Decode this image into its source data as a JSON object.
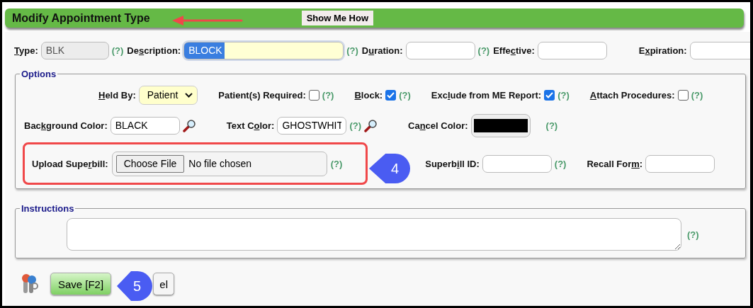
{
  "header": {
    "title": "Modify Appointment Type",
    "button": "Show Me How"
  },
  "top_fields": [
    {
      "kind": "readonly",
      "label": {
        "key": "T",
        "post": "ype:"
      },
      "value": "BLK",
      "help": "(?)"
    },
    {
      "kind": "text",
      "label": {
        "pre": "De",
        "key": "s",
        "post": "cription:"
      },
      "value": "BLOCK",
      "focused": true,
      "help": "(?)"
    },
    {
      "kind": "text",
      "label": {
        "pre": "D",
        "key": "u",
        "post": "ration:"
      },
      "help": "(?)"
    },
    {
      "kind": "text",
      "label": {
        "pre": "Effe",
        "key": "c",
        "post": "tive:"
      }
    },
    {
      "kind": "text",
      "label": {
        "pre": "E",
        "key": "x",
        "post": "piration:"
      }
    }
  ],
  "options": {
    "legend": "Options",
    "held_row": [
      {
        "kind": "select",
        "label": {
          "key": "H",
          "post": "eld By:"
        },
        "value": "Patient"
      },
      {
        "kind": "checkbox",
        "label": {
          "pre": "Patient(s) Required:"
        },
        "checked": false,
        "help": "(?)"
      },
      {
        "kind": "checkbox",
        "label": {
          "key": "B",
          "post": "lock:"
        },
        "checked": true,
        "help": "(?)"
      },
      {
        "kind": "checkbox",
        "label": {
          "pre": "Exc",
          "key": "l",
          "post": "ude from ME Report:"
        },
        "checked": true,
        "help": "(?)"
      },
      {
        "kind": "checkbox",
        "label": {
          "key": "A",
          "post": "ttach Procedures:"
        },
        "checked": false,
        "help": "(?)"
      }
    ],
    "color_row": [
      {
        "kind": "text",
        "label": {
          "pre": "Bac",
          "key": "k",
          "post": "ground Color:"
        },
        "value": "BLACK",
        "picker": true
      },
      {
        "kind": "text",
        "label": {
          "pre": "Text C",
          "key": "o",
          "post": "lor:"
        },
        "value": "GHOSTWHIT",
        "help": "(?)",
        "picker": true
      },
      {
        "kind": "swatch",
        "label": {
          "pre": "Ca",
          "key": "n",
          "post": "cel Color:"
        },
        "color": "#000000",
        "help": "(?)"
      }
    ],
    "superbill_row": [
      {
        "kind": "file",
        "label": {
          "pre": "Upload Supe",
          "key": "r",
          "post": "bill:"
        },
        "button": "Choose File",
        "value": "No file chosen",
        "help": "(?)",
        "highlighted": true
      },
      {
        "kind": "text",
        "label": {
          "pre": "Superb",
          "key": "i",
          "post": "ll ID:"
        },
        "help": "(?)"
      },
      {
        "kind": "text",
        "label": {
          "pre": "Recall For",
          "key": "m",
          "post": ":"
        }
      }
    ]
  },
  "instructions": {
    "legend": "Instructions",
    "help": "(?)"
  },
  "footer": {
    "buttons": [
      {
        "kind": "save",
        "label": "Save [F2]"
      },
      {
        "kind": "cancel",
        "label": "el"
      }
    ]
  },
  "callouts": [
    {
      "label": "4"
    },
    {
      "label": "5"
    }
  ]
}
